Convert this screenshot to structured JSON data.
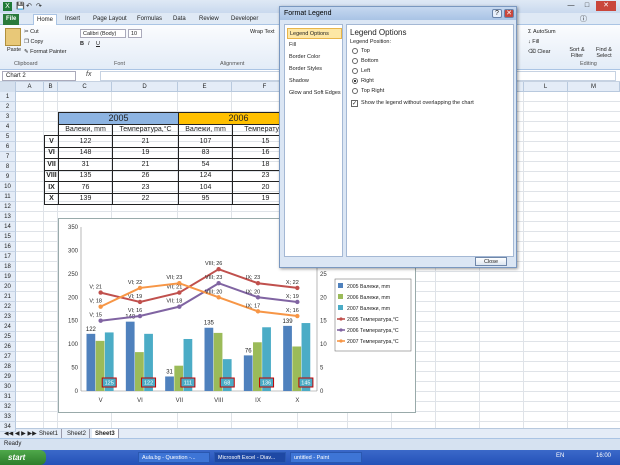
{
  "tabs": [
    "File",
    "Home",
    "Insert",
    "Page Layout",
    "Formulas",
    "Data",
    "Review",
    "Developer"
  ],
  "ribbon": {
    "paste": "Paste",
    "cut": "Cut",
    "copy": "Copy",
    "format_painter": "Format Painter",
    "font_name": "Calibri (Body)",
    "font_size": "10",
    "wrap_text": "Wrap Text",
    "autosum": "AutoSum",
    "fill": "Fill",
    "clear": "Clear",
    "sort_filter": "Sort & Filter",
    "find_select": "Find & Select",
    "groups": {
      "clipboard": "Clipboard",
      "font": "Font",
      "alignment": "Alignment",
      "editing": "Editing"
    }
  },
  "name_box": "Chart 2",
  "columns": [
    "A",
    "B",
    "C",
    "D",
    "E",
    "F",
    "G",
    "H",
    "I",
    "J",
    "K",
    "L",
    "M"
  ],
  "rows": [
    "1",
    "2",
    "3",
    "4",
    "5",
    "6",
    "7",
    "8",
    "9",
    "10",
    "11",
    "12",
    "13",
    "14",
    "15",
    "16",
    "17",
    "18",
    "19",
    "20",
    "21",
    "22",
    "23",
    "24",
    "25",
    "26",
    "27",
    "28",
    "29",
    "30",
    "31",
    "32",
    "33",
    "34"
  ],
  "table": {
    "year1": "2005",
    "year2": "2006",
    "h1": "Валежи, mm",
    "h2": "Температура,°C",
    "h3": "Валежи, mm",
    "h4": "Температура",
    "rows": [
      [
        "V",
        "122",
        "21",
        "107",
        "15"
      ],
      [
        "VI",
        "148",
        "19",
        "83",
        "16"
      ],
      [
        "VII",
        "31",
        "21",
        "54",
        "18"
      ],
      [
        "VIII",
        "135",
        "26",
        "124",
        "23"
      ],
      [
        "IX",
        "76",
        "23",
        "104",
        "20"
      ],
      [
        "X",
        "139",
        "22",
        "95",
        "19"
      ]
    ]
  },
  "chart_data": {
    "type": "bar",
    "categories": [
      "V",
      "VI",
      "VII",
      "VIII",
      "IX",
      "X"
    ],
    "series": [
      {
        "name": "2005 Валежи, mm",
        "values": [
          122,
          148,
          31,
          135,
          76,
          139
        ]
      },
      {
        "name": "2006 Валежи, mm",
        "values": [
          107,
          83,
          54,
          124,
          104,
          95
        ]
      },
      {
        "name": "2007 Валежи, mm",
        "values": [
          125,
          122,
          111,
          68,
          136,
          145
        ]
      }
    ],
    "line_series": [
      {
        "name": "2005 Температура,°C",
        "values": [
          21,
          19,
          21,
          26,
          23,
          22
        ]
      },
      {
        "name": "2006 Температура,°C",
        "values": [
          15,
          16,
          18,
          23,
          20,
          19
        ]
      },
      {
        "name": "2007 Температура,°C",
        "values": [
          18,
          22,
          23,
          20,
          17,
          16
        ]
      }
    ],
    "bar_labels": [
      "122",
      "148",
      "31",
      "135",
      "76",
      "139"
    ],
    "boxed_labels": [
      "125",
      "122",
      "111",
      "68",
      "136",
      "145"
    ],
    "line_labels": [
      [
        "V; 21",
        "VI; 19",
        "VII; 21",
        "VIII; 26",
        "IX; 23",
        "X; 22"
      ],
      [
        "V; 15",
        "VI; 16",
        "VII; 18",
        "VIII; 23",
        "IX; 20",
        "X; 19"
      ],
      [
        "V; 18",
        "VI; 22",
        "VII; 23",
        "VIII; 20",
        "IX; 17",
        "X; 16"
      ]
    ],
    "ylim": [
      0,
      350
    ],
    "yticks": [
      "0",
      "50",
      "100",
      "150",
      "200",
      "250",
      "300",
      "350"
    ],
    "y2lim": [
      0,
      35
    ],
    "y2ticks": [
      "0",
      "5",
      "10",
      "15",
      "20",
      "25",
      "30"
    ],
    "colors": [
      "#4f81bd",
      "#9bbb59",
      "#4bacc6",
      "#c0504d",
      "#8064a2",
      "#f79646"
    ],
    "legend_position": "right"
  },
  "dialog": {
    "title": "Format Legend",
    "nav": [
      "Legend Options",
      "Fill",
      "Border Color",
      "Border Styles",
      "Shadow",
      "Glow and Soft Edges"
    ],
    "heading": "Legend Options",
    "position_label": "Legend Position:",
    "options": [
      "Top",
      "Bottom",
      "Left",
      "Right",
      "Top Right"
    ],
    "selected": "Right",
    "checkbox_label": "Show the legend without overlapping the chart",
    "close": "Close"
  },
  "sheets": [
    "Sheet1",
    "Sheet2",
    "Sheet3"
  ],
  "status": "Ready",
  "taskbar": {
    "start": "start",
    "items": [
      "Aula.bg - Question -...",
      "Microsoft Excel - Diav...",
      "untitled - Paint"
    ],
    "lang": "EN",
    "clock": "16:00"
  }
}
